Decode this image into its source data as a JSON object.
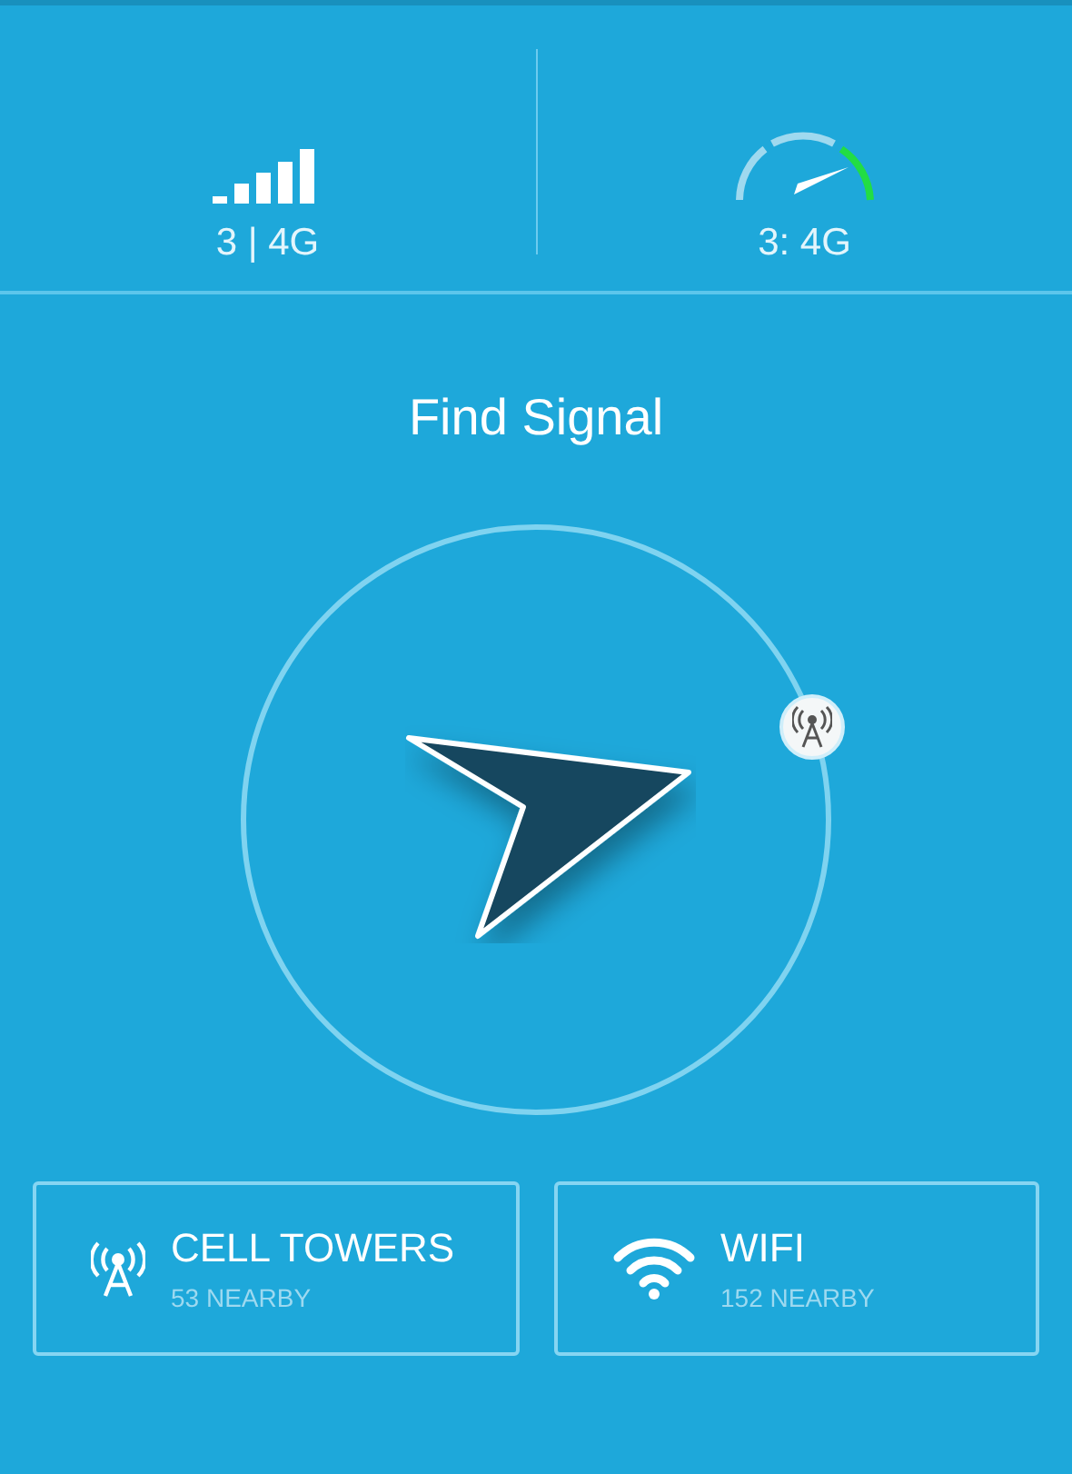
{
  "stats": [
    {
      "kind": "signal",
      "label": "3 | 4G"
    },
    {
      "kind": "speed",
      "label": "3: 4G"
    }
  ],
  "title": "Find Signal",
  "cards": [
    {
      "kind": "tower",
      "title": "CELL TOWERS",
      "subtitle": "53 NEARBY"
    },
    {
      "kind": "wifi",
      "title": "WIFI",
      "subtitle": "152 NEARBY"
    }
  ]
}
